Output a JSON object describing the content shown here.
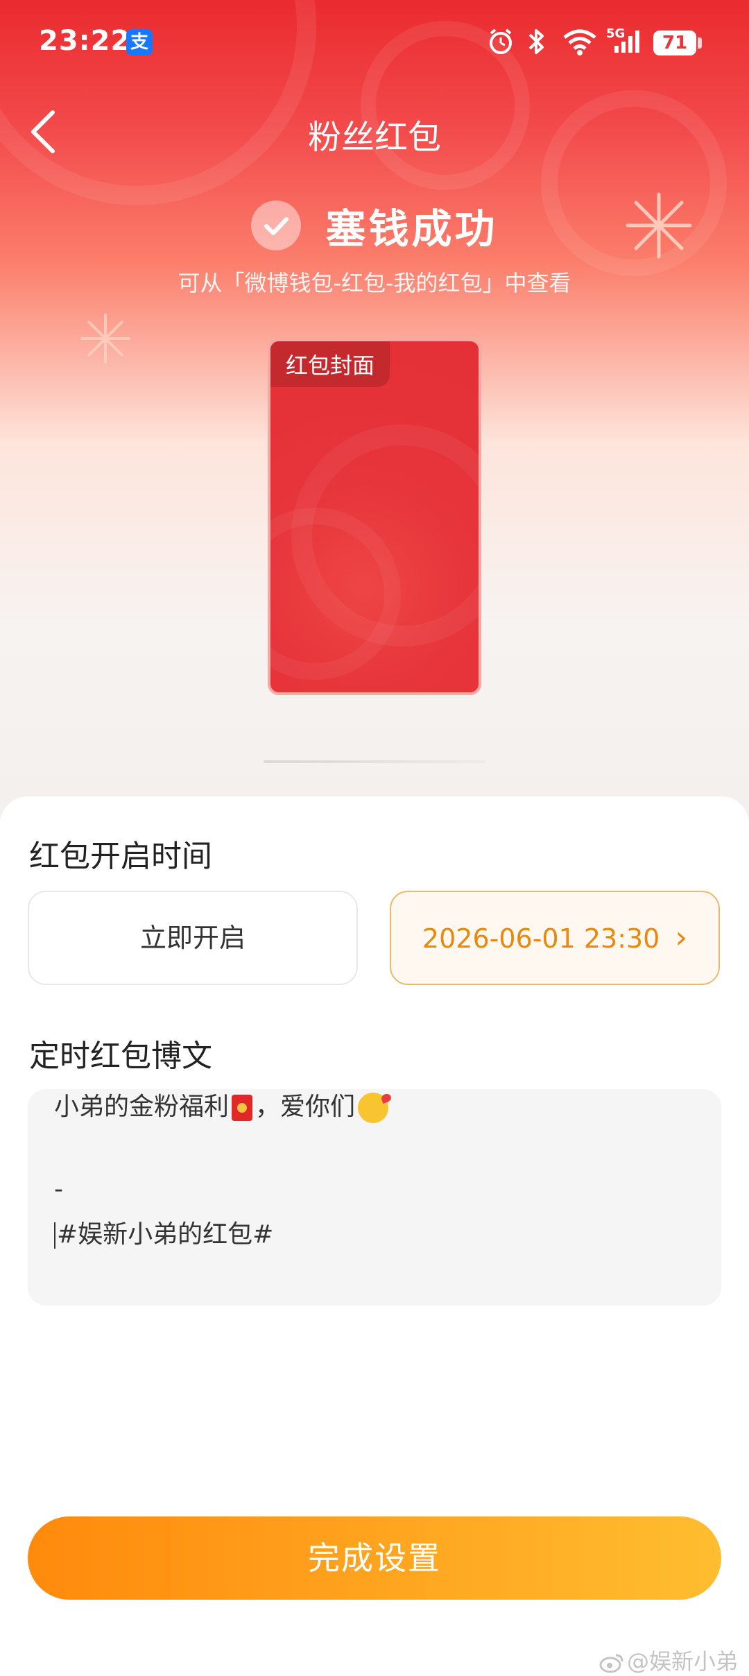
{
  "status_bar": {
    "time": "23:22",
    "alipay_glyph": "支",
    "network": "5G",
    "battery": "71"
  },
  "nav": {
    "title": "粉丝红包",
    "back_icon": "chevron-left-icon"
  },
  "success": {
    "title": "塞钱成功",
    "subtitle": "可从「微博钱包-红包-我的红包」中查看"
  },
  "cover": {
    "tag": "红包封面"
  },
  "open_time": {
    "heading": "红包开启时间",
    "option_now": "立即开启",
    "option_scheduled": "2026-06-01 23:30",
    "scheduled_arrow": "›"
  },
  "post": {
    "heading": "定时红包博文",
    "line1_a": "小弟的金粉福利",
    "line1_b": "，爱你们",
    "line2": "-",
    "line3": "#娱新小弟的红包#"
  },
  "actions": {
    "done": "完成设置"
  },
  "watermark": "@娱新小弟",
  "colors": {
    "primary_red": "#e8353a",
    "accent_orange": "#e9880f",
    "button_gradient_start": "#ff8a0c",
    "button_gradient_end": "#ffbd30"
  }
}
